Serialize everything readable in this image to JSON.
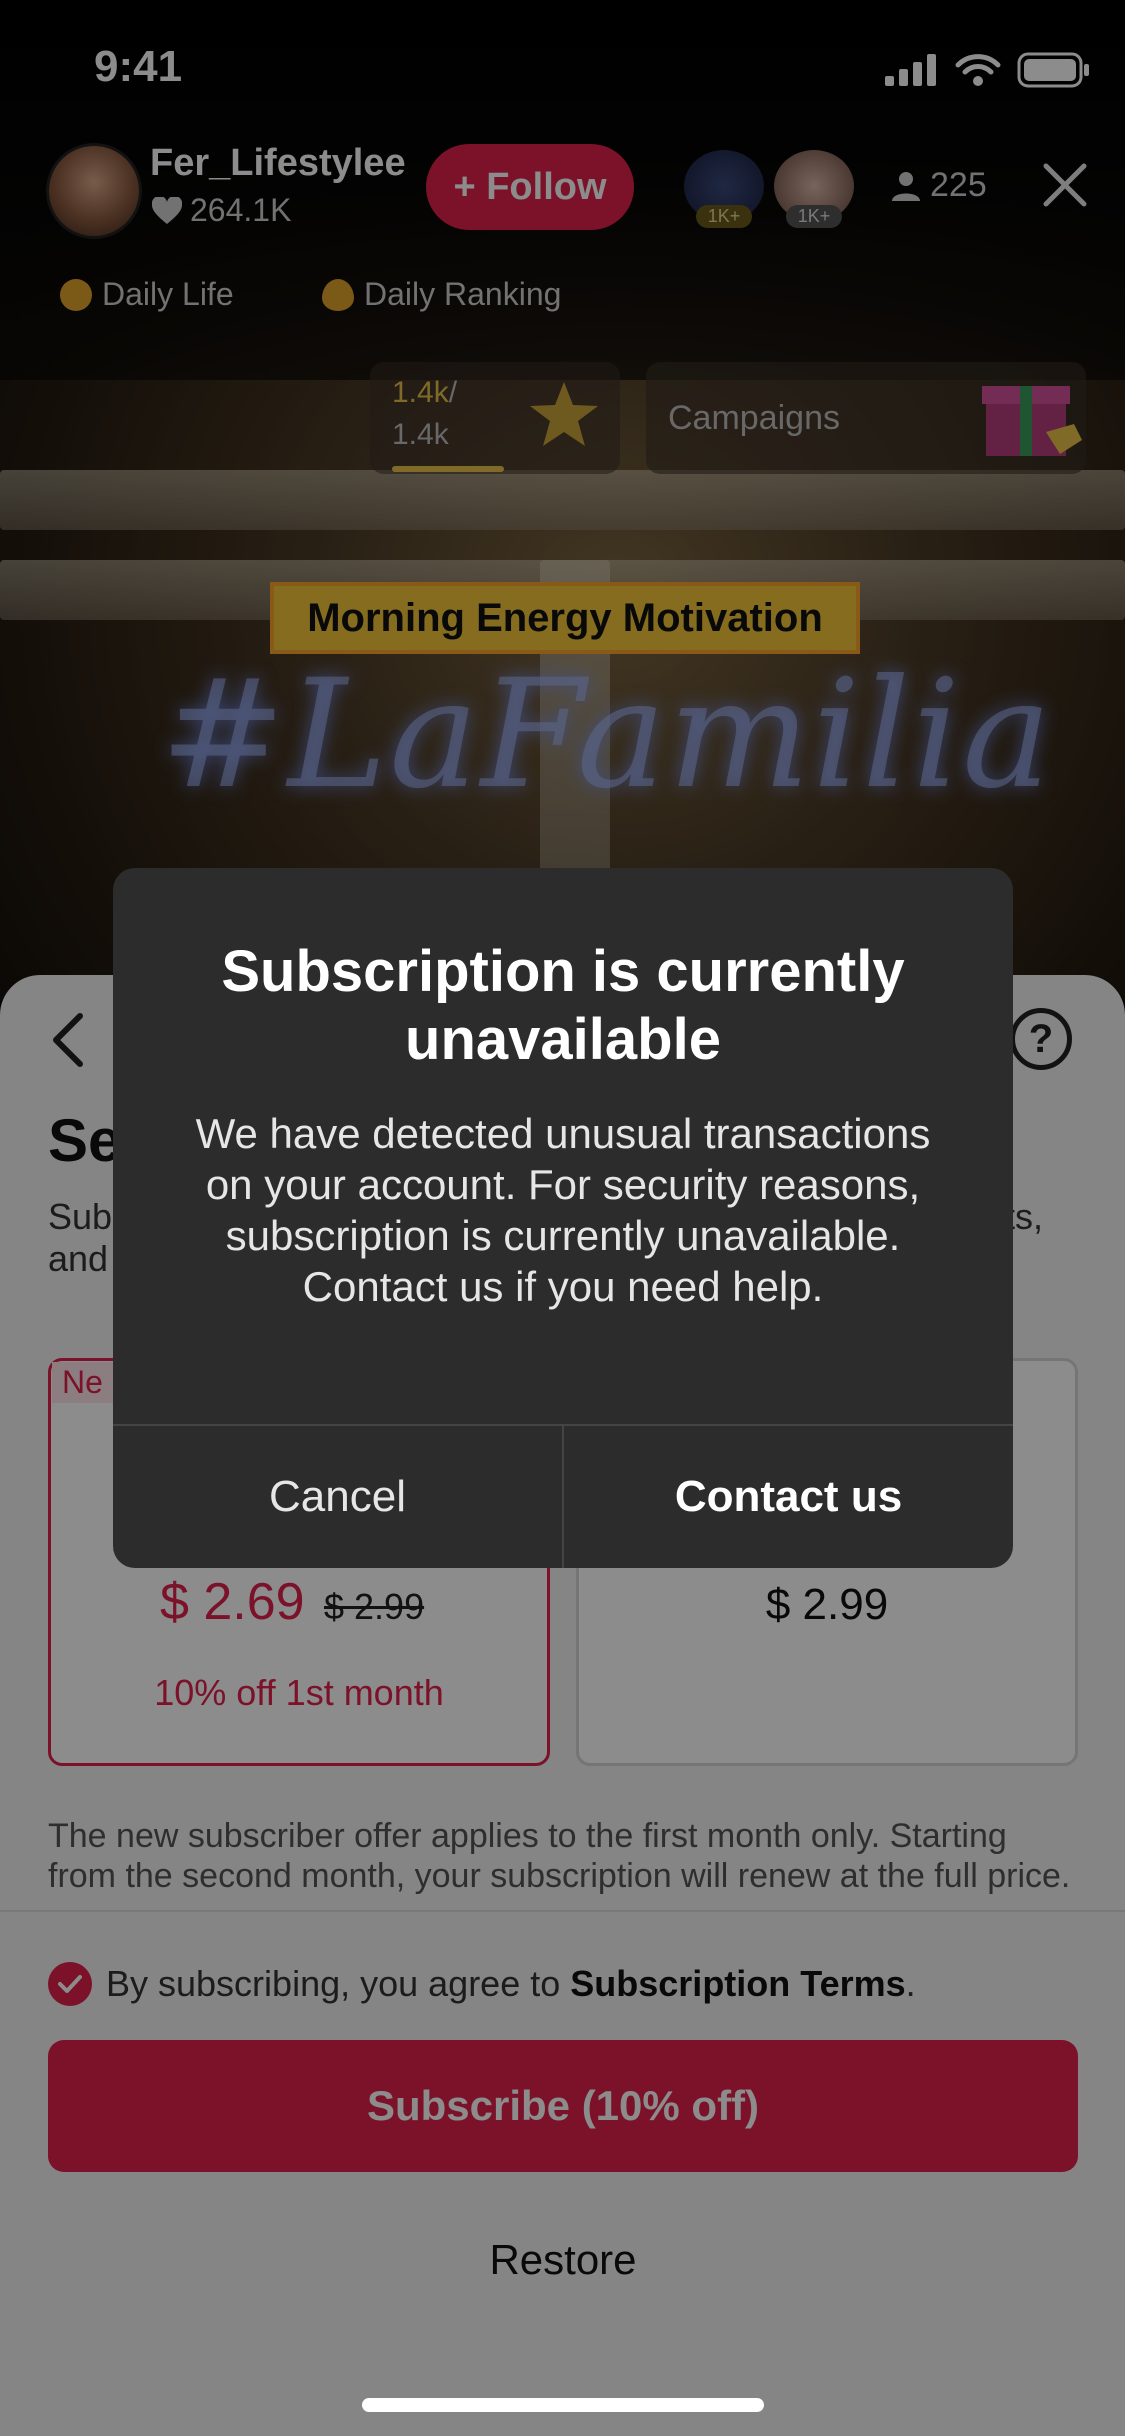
{
  "status_bar": {
    "time": "9:41"
  },
  "header": {
    "user_name": "Fer_Lifestylee",
    "likes": "264.1K",
    "follow_label": "+ Follow",
    "badge_1": "1K+",
    "badge_2": "1K+",
    "viewer_count": "225",
    "chips": [
      "Daily Life",
      "Daily Ranking"
    ],
    "rank_progress_current": "1.4k",
    "rank_progress_sep": "/",
    "rank_progress_total": "1.4k",
    "campaigns_label": "Campaigns"
  },
  "stream": {
    "banner_text": "Morning Energy Motivation",
    "neon_text": "#LaFamilia"
  },
  "sheet": {
    "title_visible": "Se",
    "desc_left": "Sub\nand",
    "desc_right": "ts,",
    "plan_tag": "Ne",
    "plan_a_price": "$ 2.69",
    "plan_a_old_price": "$ 2.99",
    "plan_a_note": "10% off 1st month",
    "plan_b_price": "$ 2.99",
    "offer_note": "The new subscriber offer applies to the first month only. Starting from the second month, your subscription will renew at the full price.",
    "terms_prefix": "By subscribing, you agree to ",
    "terms_link": "Subscription Terms",
    "terms_suffix": ".",
    "subscribe_label": "Subscribe (10% off)",
    "restore_label": "Restore"
  },
  "modal": {
    "title": "Subscription is currently unavailable",
    "body": "We have detected unusual transactions on your account. For security reasons, subscription is currently unavailable. Contact us if you need help.",
    "cancel_label": "Cancel",
    "contact_label": "Contact us"
  },
  "colors": {
    "accent": "#e0224d",
    "modal_bg": "#2c2c2c",
    "banner_yellow": "#f3c53a"
  }
}
